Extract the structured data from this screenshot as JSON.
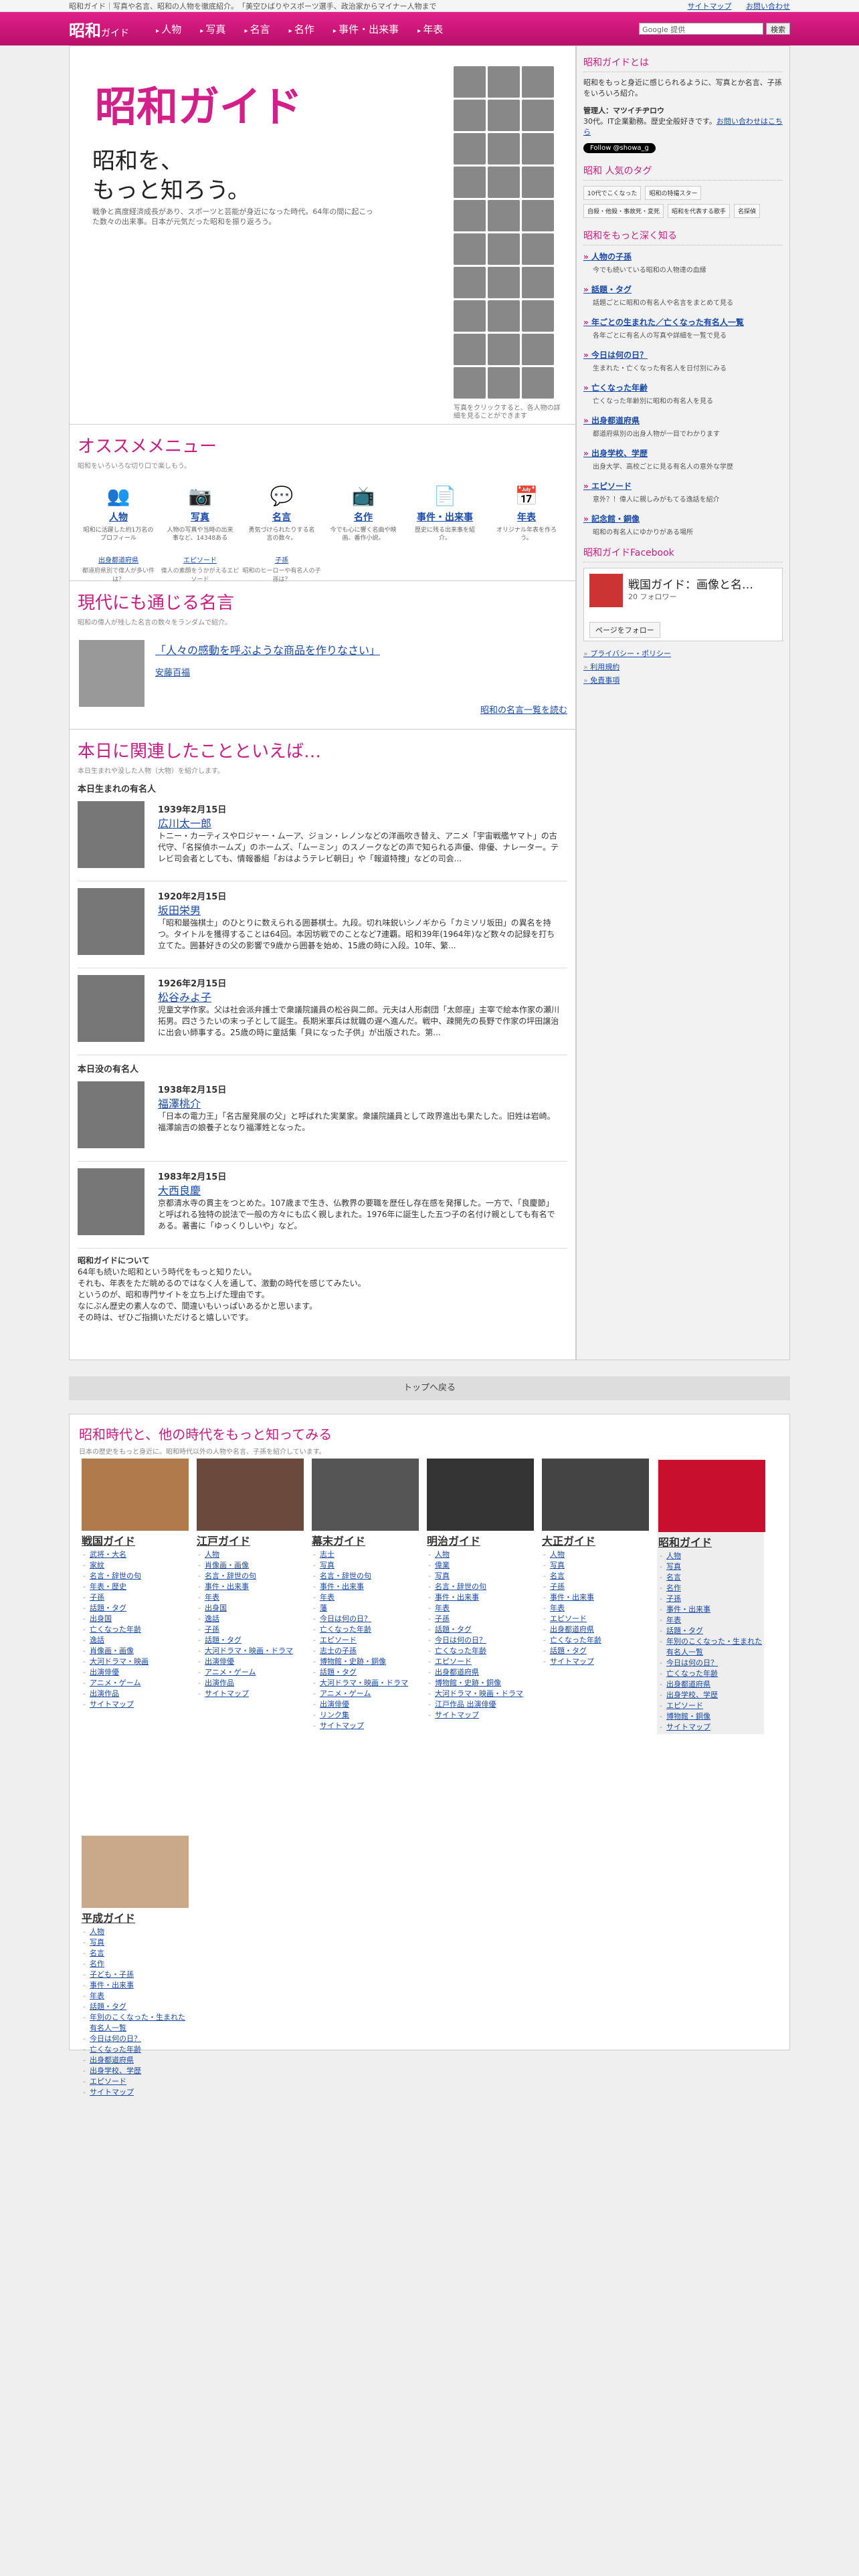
{
  "topstrip": {
    "text": "昭和ガイド｜写真や名言、昭和の人物を徹底紹介。　「美空ひばりやスポーツ選手、政治家からマイナー人物まで",
    "links": [
      "サイトマップ",
      "お問い合わせ"
    ]
  },
  "header": {
    "logo": "昭和",
    "logo_small": "ガイド",
    "nav": [
      "人物",
      "写真",
      "名言",
      "名作",
      "事件・出来事",
      "年表"
    ],
    "search_placeholder": "Google 提供",
    "search_button": "検索"
  },
  "hero": {
    "title": "昭和ガイド",
    "catch1": "昭和を、",
    "catch2": "もっと知ろう。",
    "desc": "戦争と高度経済成長があり、スポーツと芸能が身近になった時代。64年の間に起こった数々の出来事。日本が元気だった昭和を振り返ろう。",
    "caption": "写真をクリックすると、各人物の詳細を見ることができます"
  },
  "osusume": {
    "title": "オススメメニュー",
    "sub": "昭和をいろいろな切り口で楽しもう。",
    "items": [
      {
        "icon": "person-icon",
        "glyph": "👥",
        "label": "人物",
        "desc": "昭和に活躍した約1万名のプロフィール"
      },
      {
        "icon": "camera-icon",
        "glyph": "📷",
        "label": "写真",
        "desc": "人物の写真や当時の出来事など、14348ある"
      },
      {
        "icon": "speech-icon",
        "glyph": "💬",
        "label": "名言",
        "desc": "勇気づけられたりする名言の数々。"
      },
      {
        "icon": "tv-icon",
        "glyph": "📺",
        "label": "名作",
        "desc": "今でも心に響く名曲や映画、番作小説。"
      },
      {
        "icon": "document-icon",
        "glyph": "📄",
        "label": "事件・出来事",
        "desc": "歴史に残る出来事を紹介。"
      },
      {
        "icon": "calendar-icon",
        "glyph": "📅",
        "label": "年表",
        "desc": "オリジナル年表を作ろう。"
      }
    ],
    "mini": [
      {
        "label": "出身都道府県",
        "desc": "都道府県別で偉人が多い件は？"
      },
      {
        "label": "エピソード",
        "desc": "偉人の素顔をうかがえるエピソード"
      },
      {
        "label": "子孫",
        "desc": "昭和のヒーローや有名人の子孫は？"
      }
    ]
  },
  "meigen": {
    "title": "現代にも通じる名言",
    "sub": "昭和の偉人が残した名言の数々をランダムで紹介。",
    "quote": "「人々の感動を呼ぶような商品を作りなさい」",
    "author": "安藤百福",
    "more": "昭和の名言一覧を読む"
  },
  "today": {
    "title": "本日に関連したことといえば…",
    "sub": "本日生まれや没した人物（大物）を紹介します。",
    "born_h": "本日生まれの有名人",
    "died_h": "本日没の有名人",
    "born": [
      {
        "date": "1939年2月15日",
        "name": "広川太一郎",
        "bio": "トニー・カーティスやロジャー・ムーア、ジョン・レノンなどの洋画吹き替え、アニメ「宇宙戦艦ヤマト」の古代守、「名探偵ホームズ」のホームズ、「ムーミン」のスノークなどの声で知られる声優、俳優、ナレーター。テレビ司会者としても、情報番組「おはようテレビ朝日」や「報道特捜」などの司会..."
      },
      {
        "date": "1920年2月15日",
        "name": "坂田栄男",
        "bio": "「昭和最強棋士」のひとりに数えられる囲碁棋士。九段。切れ味鋭いシノギから「カミソリ坂田」の異名を持つ。タイトルを獲得することは64回。本因坊戦でのことなど7連覇。昭和39年(1964年)など数々の記録を打ち立てた。囲碁好きの父の影響で9歳から囲碁を始め、15歳の時に入段。10年、繁..."
      },
      {
        "date": "1926年2月15日",
        "name": "松谷みよ子",
        "bio": "児童文学作家。父は社会派弁護士で衆議院議員の松谷與二郎。元夫は人形劇団「太郎座」主宰で絵本作家の瀬川拓男。四さうたいの末っ子として誕生。長期米軍兵は就職の遅へ進んだ。戦中、疎開先の長野で作家の坪田譲治に出会い師事する。25歳の時に童話集「貝になった子供」が出版された。第..."
      }
    ],
    "died": [
      {
        "date": "1938年2月15日",
        "name": "福澤桃介",
        "bio": "「日本の電力王」「名古屋発展の父」と呼ばれた実業家。衆議院議員として政界進出も果たした。旧姓は岩崎。福澤諭吉の娘養子となり福澤姓となった。"
      },
      {
        "date": "1983年2月15日",
        "name": "大西良慶",
        "bio": "京都清水寺の貫主をつとめた。107歳まで生き、仏教界の要職を歴任し存在感を発揮した。一方で、「良慶節」と呼ばれる独特の説法で一般の方々にも広く親しまれた。1976年に誕生した五つ子の名付け親としても有名である。著書に「ゆっくりしいや」など。"
      }
    ],
    "about_h": "昭和ガイドについて",
    "about": [
      "64年も続いた昭和という時代をもっと知りたい。",
      "それも、年表をただ眺めるのではなく人を通して、激動の時代を感じてみたい。",
      "というのが、昭和専門サイトを立ち上げた理由です。",
      "なにぶん歴史の素人なので、間違いもいっぱいあるかと思います。",
      "その時は、ぜひご指摘いただけると嬉しいです。"
    ]
  },
  "side": {
    "about_h": "昭和ガイドとは",
    "about_p": "昭和をもっと身近に感じられるように、写真とか名言、子孫をいろいろ紹介。",
    "admin": "管理人：マツイチヂロウ",
    "admin_p": "30代。IT企業勤務。歴史全般好きです。",
    "contact": "お問い合わせはこちら",
    "twitter": "Follow @showa_g",
    "tags_h": "昭和 人気のタグ",
    "tags": [
      "10代でこくなった",
      "昭和の特撮スター",
      "自殺・他殺・事故死・変死",
      "昭和を代表する歌手",
      "名探偵"
    ],
    "deep_h": "昭和をもっと深く知る",
    "deep": [
      {
        "t": "人物の子孫",
        "d": "今でも続いている昭和の人物達の血縁"
      },
      {
        "t": "話題・タグ",
        "d": "話題ごとに昭和の有名人や名言をまとめて見る"
      },
      {
        "t": "年ごとの生まれた／亡くなった有名人一覧",
        "d": "各年ごとに有名人の写真や詳細を一覧で見る"
      },
      {
        "t": "今日は何の日？",
        "d": "生まれた・亡くなった有名人を日付別にみる"
      },
      {
        "t": "亡くなった年齢",
        "d": "亡くなった年齢別に昭和の有名人を見る"
      },
      {
        "t": "出身都道府県",
        "d": "都道府県別の出身人物が一目でわかります"
      },
      {
        "t": "出身学校、学歴",
        "d": "出身大学、高校ごとに見る有名人の意外な学歴"
      },
      {
        "t": "エピソード",
        "d": "意外？！偉人に親しみがもてる逸話を紹介"
      },
      {
        "t": "記念館・銅像",
        "d": "昭和の有名人にゆかりがある場所"
      }
    ],
    "fb_h": "昭和ガイドFacebook",
    "fb_name": "戦国ガイド：画像と名…",
    "fb_follow": "20 フォロワー",
    "fb_btn": "ページをフォロー",
    "links": [
      "プライバシー・ポリシー",
      "利用規約",
      "免責事項"
    ]
  },
  "totop": "トップへ戻る",
  "other": {
    "title": "昭和時代と、他の時代をもっと知ってみる",
    "sub": "日本の歴史をもっと身近に。昭和時代以外の人物や名言、子孫を紹介しています。",
    "eras": [
      {
        "name": "戦国ガイド",
        "items": [
          "武将・大名",
          "家紋",
          "名言・辞世の句",
          "年表・歴史",
          "子孫",
          "話題・タグ",
          "出身国",
          "亡くなった年齢",
          "逸話",
          "肖像画・画像",
          "大河ドラマ・映画",
          "出演俳優",
          "アニメ・ゲーム",
          "出演作品",
          "サイトマップ"
        ]
      },
      {
        "name": "江戸ガイド",
        "items": [
          "人物",
          "肖像画・画像",
          "名言・辞世の句",
          "事件・出来事",
          "年表",
          "出身国",
          "逸話",
          "子孫",
          "話題・タグ",
          "大河ドラマ・映画・ドラマ",
          "出演俳優",
          "アニメ・ゲーム",
          "出演作品",
          "サイトマップ"
        ]
      },
      {
        "name": "幕末ガイド",
        "items": [
          "志士",
          "写真",
          "名言・辞世の句",
          "事件・出来事",
          "年表",
          "藩",
          "今日は何の日？",
          "亡くなった年齢",
          "エピソード",
          "志士の子孫",
          "博物館・史跡・銅像",
          "話題・タグ",
          "大河ドラマ・映画・ドラマ",
          "アニメ・ゲーム",
          "出演俳優",
          "リンク集",
          "サイトマップ"
        ]
      },
      {
        "name": "明治ガイド",
        "items": [
          "人物",
          "偉業",
          "写真",
          "名言・辞世の句",
          "事件・出来事",
          "年表",
          "子孫",
          "話題・タグ",
          "今日は何の日？",
          "亡くなった年齢",
          "エピソード",
          "出身都道府県",
          "博物館・史跡・銅像",
          "大河ドラマ・映画・ドラマ",
          "江戸作品 出演俳優",
          "サイトマップ"
        ]
      },
      {
        "name": "大正ガイド",
        "items": [
          "人物",
          "写真",
          "名言",
          "子孫",
          "事件・出来事",
          "年表",
          "エピソード",
          "出身都道府県",
          "亡くなった年齢",
          "話題・タグ",
          "サイトマップ"
        ]
      },
      {
        "name": "昭和ガイド",
        "items": [
          "人物",
          "写真",
          "名言",
          "名作",
          "子孫",
          "事件・出来事",
          "年表",
          "話題・タグ",
          "年別のこくなった・生まれた有名人一覧",
          "今日は何の日？",
          "亡くなった年齢",
          "出身都道府県",
          "出身学校、学歴",
          "エピソード",
          "博物館・銅像",
          "サイトマップ"
        ]
      },
      {
        "name": "平成ガイド",
        "items": [
          "人物",
          "写真",
          "名言",
          "名作",
          "子ども・子孫",
          "事件・出来事",
          "年表",
          "話題・タグ",
          "年別のこくなった・生まれた有名人一覧",
          "今日は何の日？",
          "亡くなった年齢",
          "出身都道府県",
          "出身学校、学歴",
          "エピソード",
          "サイトマップ"
        ]
      }
    ]
  }
}
